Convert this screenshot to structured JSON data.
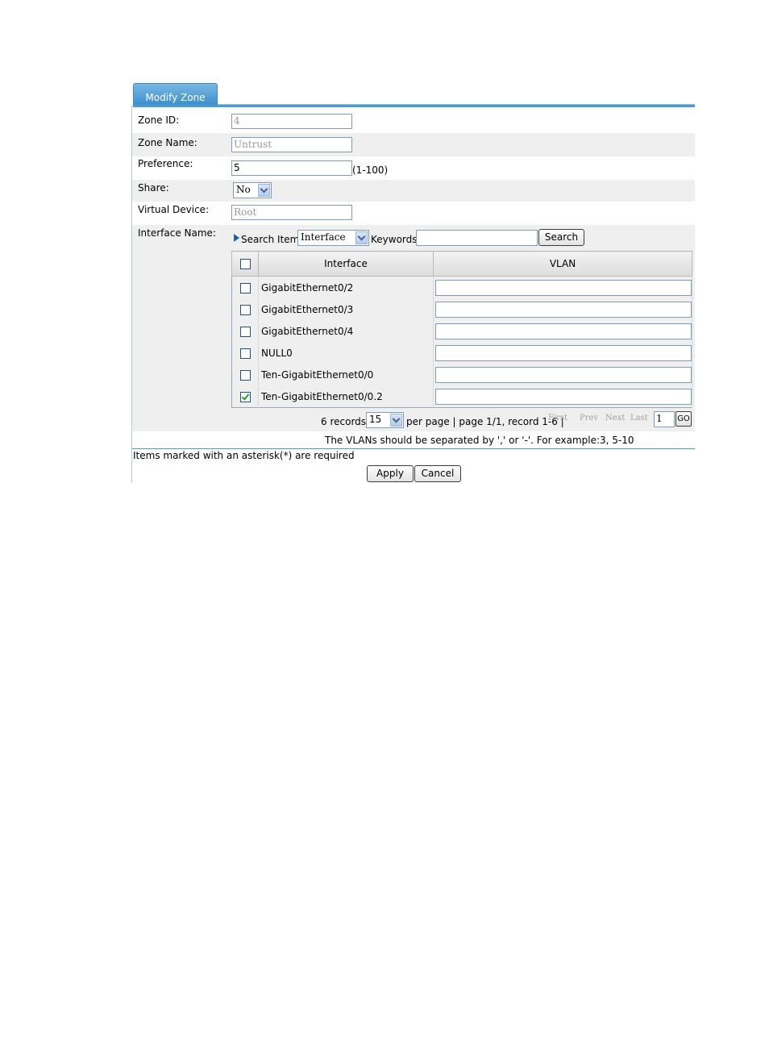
{
  "tab": {
    "label": "Modify Zone"
  },
  "form": {
    "zone_id": {
      "label": "Zone ID:",
      "value": "4"
    },
    "zone_name": {
      "label": "Zone Name:",
      "value": "Untrust"
    },
    "preference": {
      "label": "Preference:",
      "value": "5",
      "hint": "(1-100)"
    },
    "share": {
      "label": "Share:",
      "value": "No"
    },
    "virtual_device": {
      "label": "Virtual Device:",
      "value": "Root"
    },
    "interface_name": {
      "label": "Interface Name:"
    }
  },
  "search": {
    "item_label": "Search Item:",
    "item_value": "Interface",
    "keywords_label": "Keywords:",
    "keywords_value": "",
    "button": "Search"
  },
  "table": {
    "headers": [
      "Interface",
      "VLAN"
    ],
    "rows": [
      {
        "interface": "GigabitEthernet0/2",
        "checked": false,
        "vlan": ""
      },
      {
        "interface": "GigabitEthernet0/3",
        "checked": false,
        "vlan": ""
      },
      {
        "interface": "GigabitEthernet0/4",
        "checked": false,
        "vlan": ""
      },
      {
        "interface": "NULL0",
        "checked": false,
        "vlan": ""
      },
      {
        "interface": "Ten-GigabitEthernet0/0",
        "checked": false,
        "vlan": ""
      },
      {
        "interface": "Ten-GigabitEthernet0/0.2",
        "checked": true,
        "vlan": ""
      }
    ]
  },
  "pager": {
    "records": "6 records,",
    "per_page_value": "15",
    "info": "per page | page 1/1, record 1-6 |",
    "first": "First",
    "prev": "Prev",
    "next": "Next",
    "last": "Last",
    "page_value": "1",
    "go": "GO"
  },
  "note": "The VLANs should be separated by ',' or '-'. For example:3, 5-10",
  "required_note": "Items marked with an asterisk(*) are required",
  "buttons": {
    "apply": "Apply",
    "cancel": "Cancel"
  }
}
